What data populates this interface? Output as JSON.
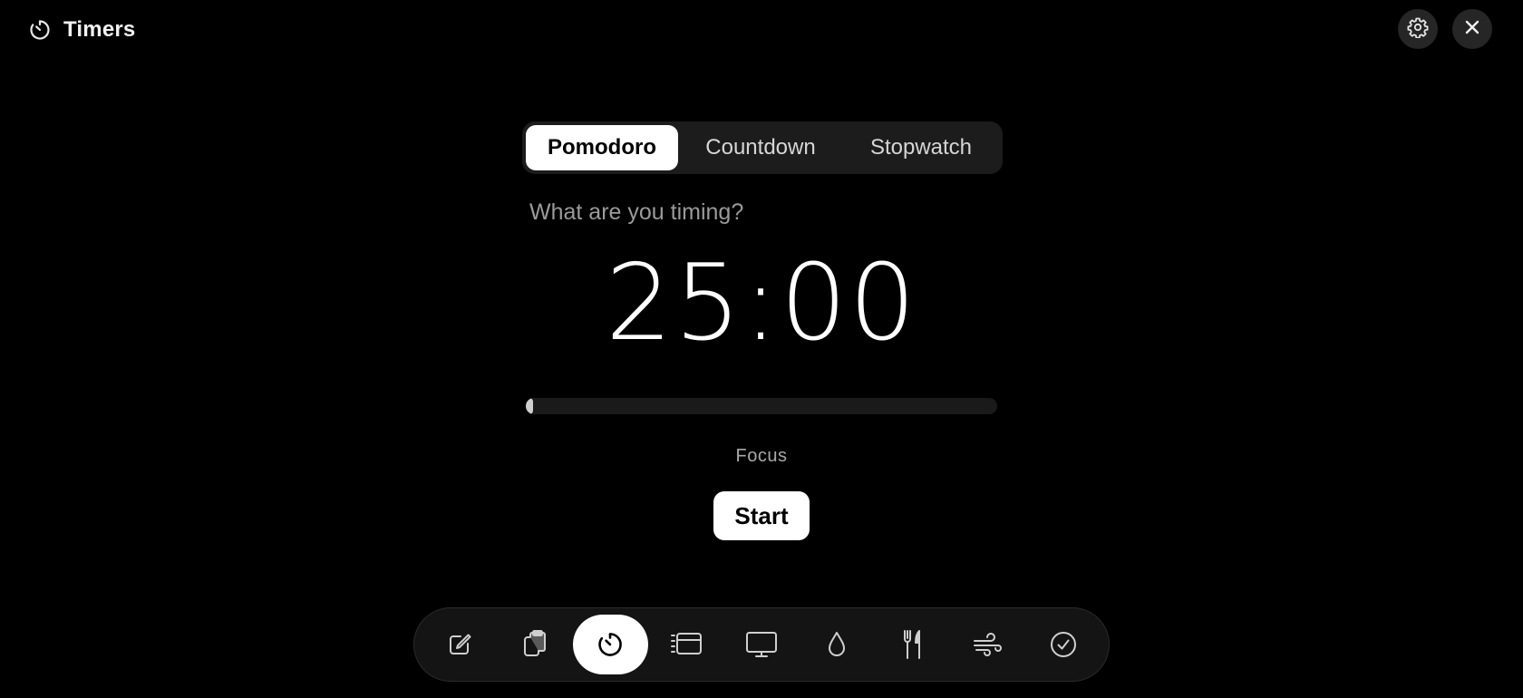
{
  "header": {
    "title": "Timers",
    "title_icon": "timer-icon",
    "settings_icon": "gear-icon",
    "close_icon": "close-icon"
  },
  "tabs": [
    {
      "label": "Pomodoro",
      "active": true
    },
    {
      "label": "Countdown",
      "active": false
    },
    {
      "label": "Stopwatch",
      "active": false
    }
  ],
  "timer": {
    "label_placeholder": "What are you timing?",
    "label_value": "",
    "time": "25:00",
    "progress": 0.0,
    "phase": "Focus",
    "start_label": "Start"
  },
  "dock": {
    "items": [
      {
        "icon": "note-edit-icon",
        "active": false
      },
      {
        "icon": "clipboard-icon",
        "active": false
      },
      {
        "icon": "timer-icon",
        "active": true
      },
      {
        "icon": "list-icon",
        "active": false
      },
      {
        "icon": "monitor-icon",
        "active": false
      },
      {
        "icon": "water-drop-icon",
        "active": false
      },
      {
        "icon": "fork-knife-icon",
        "active": false
      },
      {
        "icon": "wind-icon",
        "active": false
      },
      {
        "icon": "check-circle-icon",
        "active": false
      }
    ]
  },
  "colors": {
    "background": "#000000",
    "surface": "#1c1c1c",
    "accent": "#ffffff",
    "muted_text": "#9a9a9a"
  }
}
